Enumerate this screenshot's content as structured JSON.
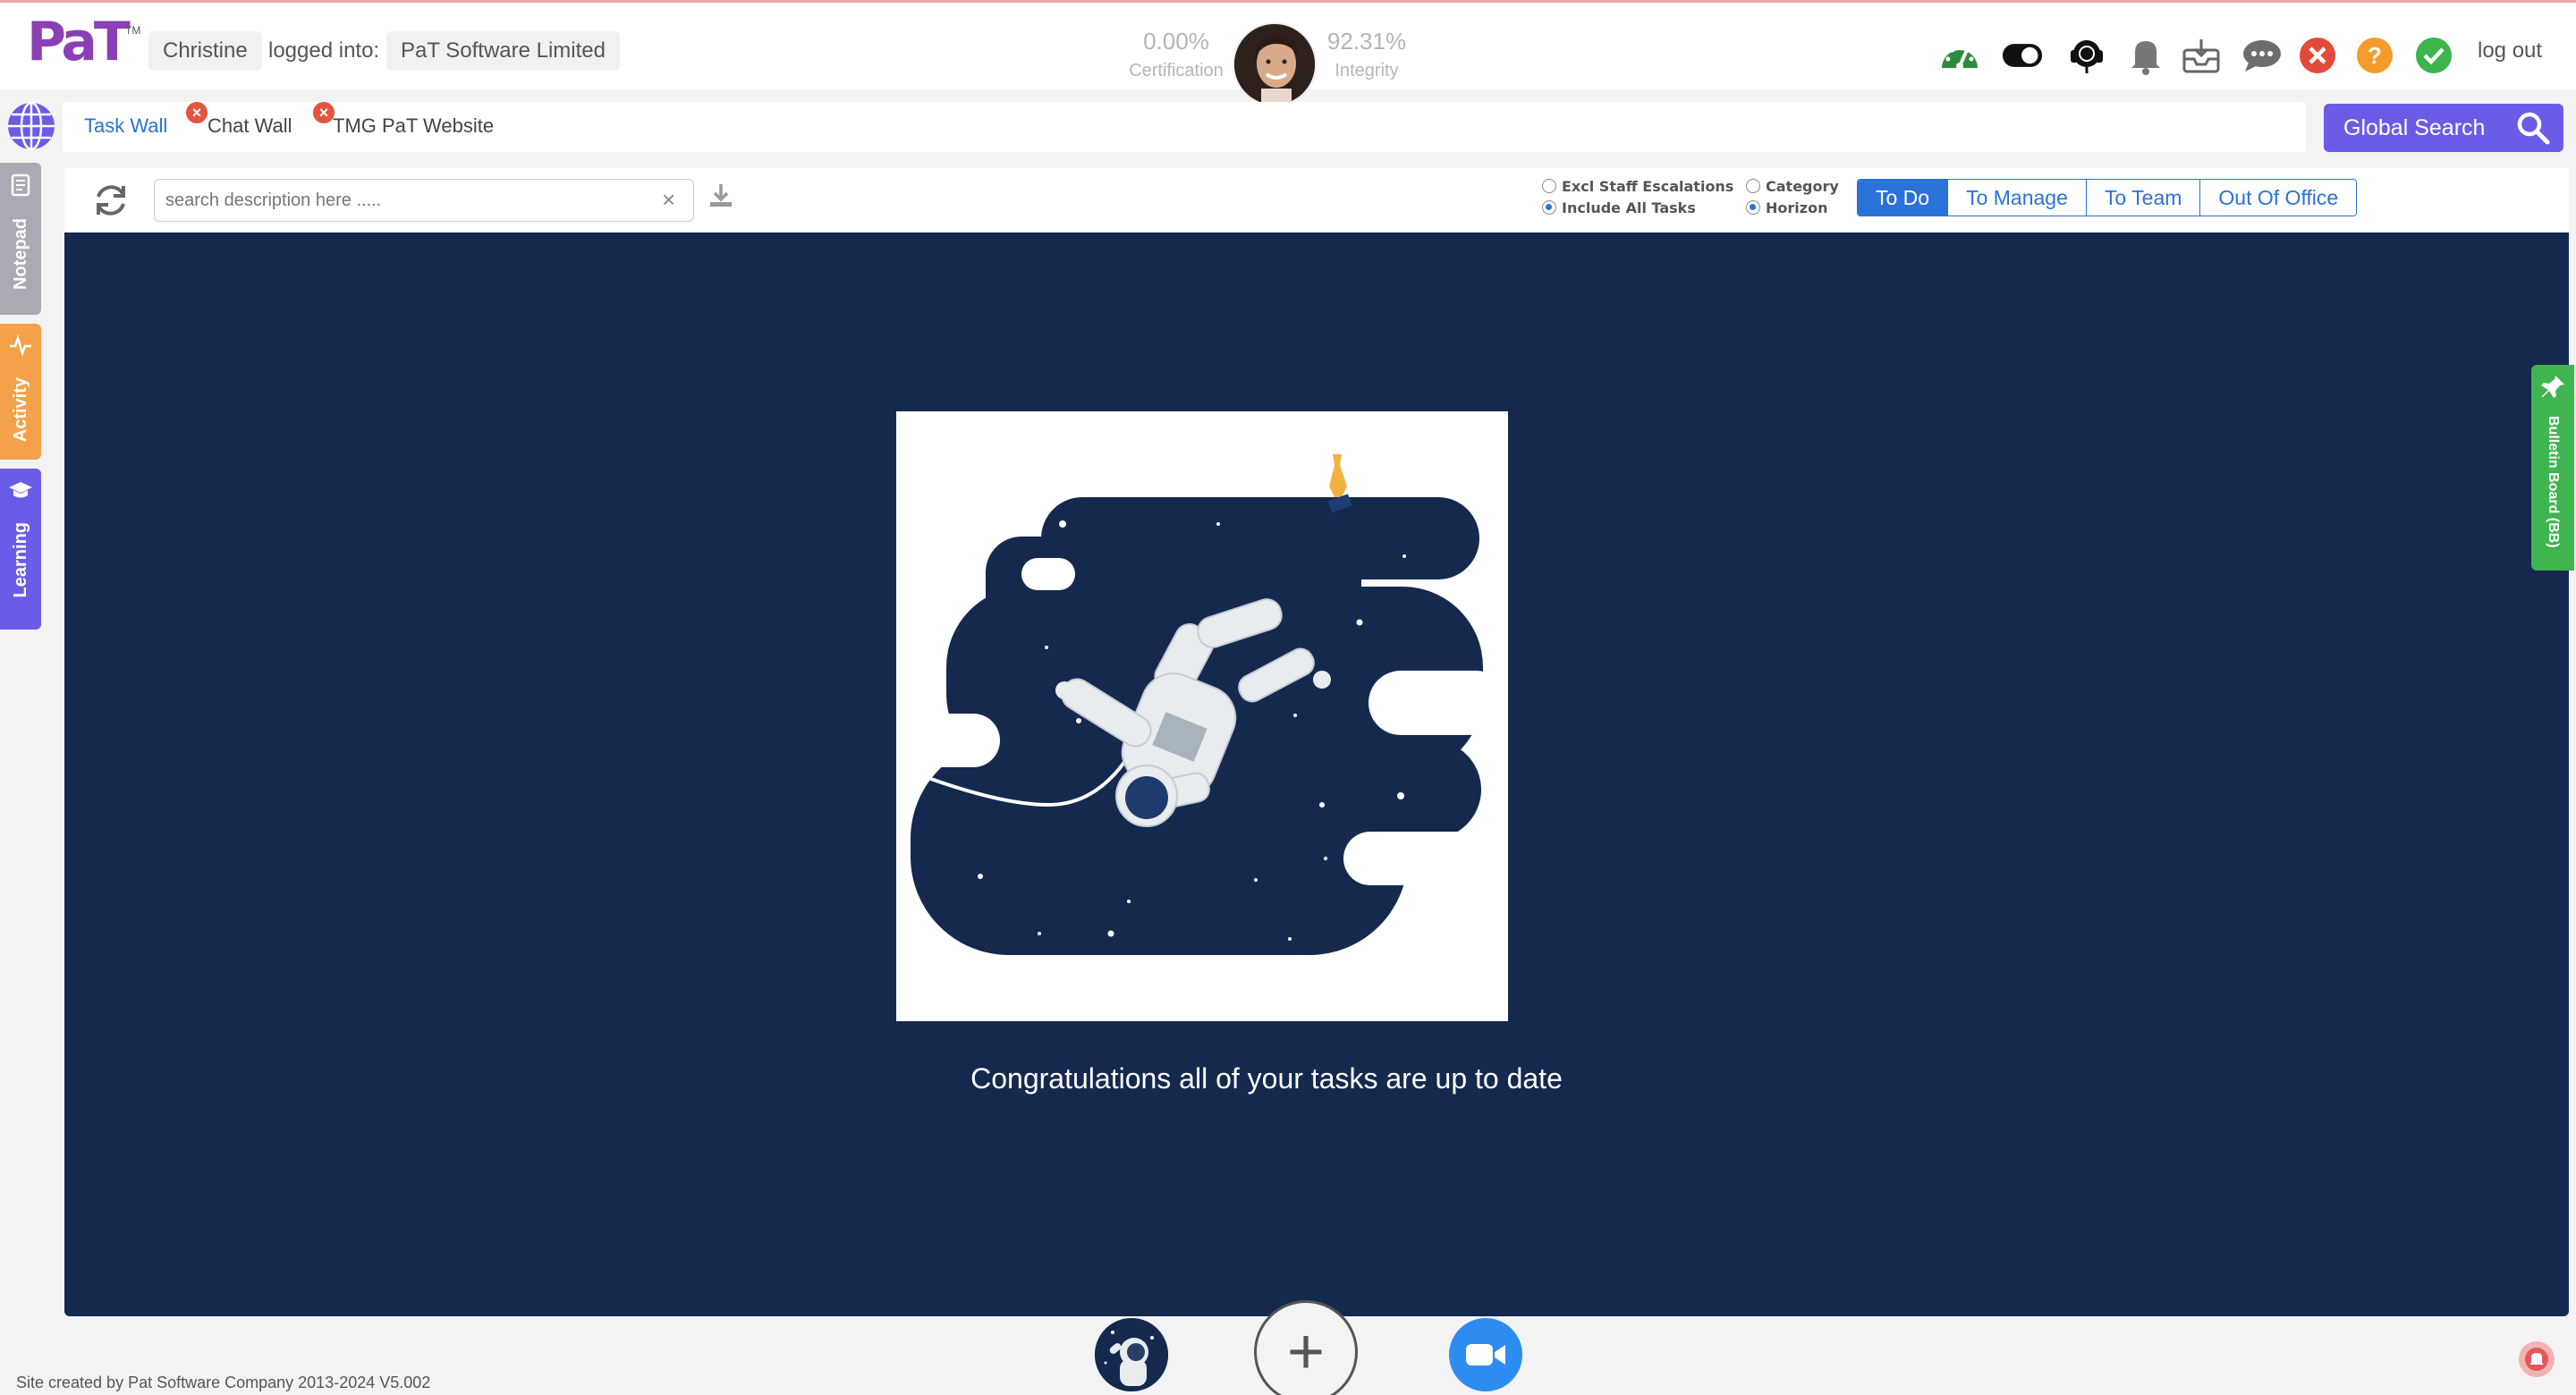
{
  "header": {
    "logo_text": "PaT",
    "logo_tm": "TM",
    "user_name": "Christine",
    "logged_into_label": "logged into:",
    "company": "PaT Software Limited",
    "certification_value": "0.00%",
    "certification_label": "Certification",
    "integrity_value": "92.31%",
    "integrity_label": "Integrity",
    "logout_label": "log out",
    "icons": [
      "speedometer-icon",
      "toggle-icon",
      "headset-icon",
      "bell-icon",
      "inbox-icon",
      "chat-bubbles-icon",
      "close-circle-icon",
      "help-circle-icon",
      "check-circle-icon"
    ]
  },
  "tabs": [
    {
      "label": "Task Wall",
      "active": true,
      "closable": false
    },
    {
      "label": "Chat Wall",
      "active": false,
      "closable": true
    },
    {
      "label": "TMG PaT Website",
      "active": false,
      "closable": true
    }
  ],
  "global_search": {
    "label": "Global Search"
  },
  "toolbar": {
    "search_placeholder": "search description here .....",
    "clear_symbol": "×",
    "filter_a": {
      "opt1": "Excl Staff Escalations",
      "opt2": "Include All Tasks",
      "selected": "Include All Tasks"
    },
    "filter_b": {
      "opt1": "Category",
      "opt2": "Horizon",
      "selected": "Horizon"
    },
    "views": [
      "To Do",
      "To Manage",
      "To Team",
      "Out Of Office"
    ],
    "selected_view": "To Do"
  },
  "main": {
    "message": "Congratulations all of your tasks are up to date"
  },
  "side_tabs": {
    "notepad": "Notepad",
    "activity": "Activity",
    "learning": "Learning",
    "bulletin": "Bulletin Board (BB)"
  },
  "footer": {
    "credit": "Site created by Pat Software Company 2013-2024 V5.002",
    "add_symbol": "+"
  },
  "colors": {
    "main_bg": "#15294f",
    "accent_blue": "#2a72d8",
    "global_search": "#6b5ce7",
    "activity_orange": "#f4a24a",
    "learning_purple": "#6b5ce7",
    "bulletin_green": "#3fb54f"
  }
}
